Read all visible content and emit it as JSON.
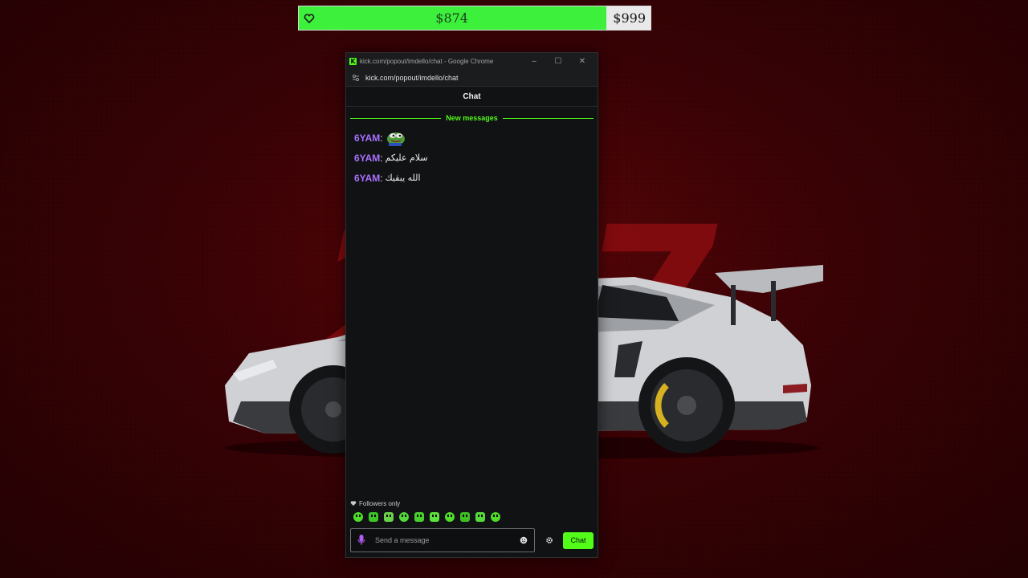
{
  "goal": {
    "current": "$874",
    "target": "$999",
    "progress_fraction": 0.875,
    "fill_color": "#3cf03c"
  },
  "background": {
    "number_text": "207",
    "accent_color": "#8a0d10"
  },
  "window": {
    "title": "kick.com/popout/imdello/chat - Google Chrome",
    "url": "kick.com/popout/imdello/chat",
    "logo_letter": "K",
    "controls": {
      "minimize": "–",
      "maximize": "☐",
      "close": "✕"
    }
  },
  "chat": {
    "header": "Chat",
    "new_messages_label": "New messages",
    "messages": [
      {
        "user": "6YAM",
        "type": "emote",
        "emote": "pepe-emote"
      },
      {
        "user": "6YAM",
        "type": "text",
        "text": "سلام عليكم"
      },
      {
        "user": "6YAM",
        "type": "text",
        "text": "الله يبقيك"
      }
    ],
    "followers_only_label": "Followers only",
    "quick_emotes": [
      "kick-emote-1",
      "kick-emote-2",
      "kick-emote-3",
      "kick-emote-4",
      "kick-emote-5",
      "kick-emote-6",
      "kick-emote-7",
      "kick-emote-8",
      "kick-emote-9",
      "kick-emote-10"
    ],
    "input_placeholder": "Send a message",
    "send_label": "Chat",
    "brand_color": "#53fc18",
    "username_color": "#a970ff"
  }
}
